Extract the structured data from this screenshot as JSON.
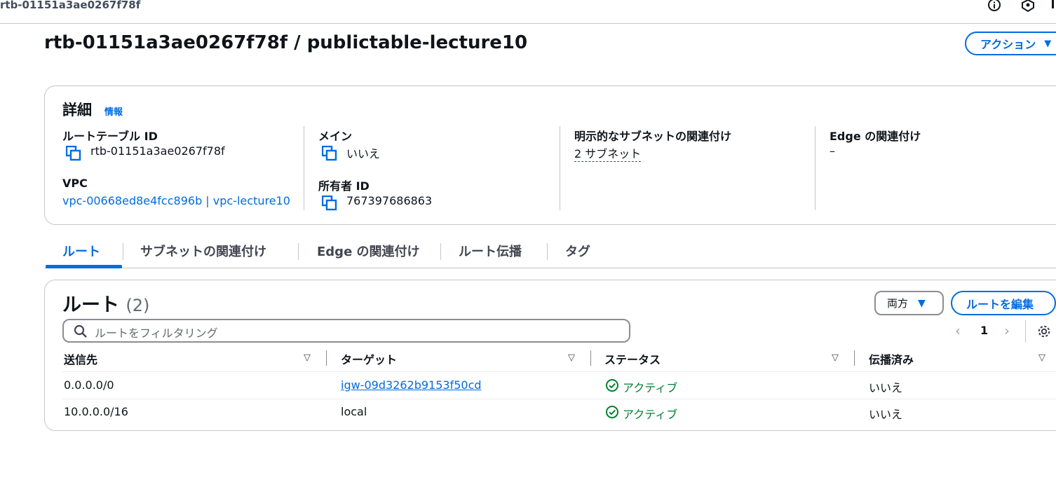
{
  "breadcrumb": "rtb-01151a3ae0267f78f",
  "page": {
    "title": "rtb-01151a3ae0267f78f / publictable-lecture10",
    "actions_label": "アクション",
    "actions_caret": "▼"
  },
  "details": {
    "title": "詳細",
    "info": "情報",
    "route_table_id_label": "ルートテーブル ID",
    "route_table_id": "rtb-01151a3ae0267f78f",
    "vpc_label": "VPC",
    "vpc_value": "vpc-00668ed8e4fcc896b | vpc-lecture10",
    "main_label": "メイン",
    "main_value": "いいえ",
    "owner_label": "所有者 ID",
    "owner_value": "767397686863",
    "explicit_label": "明示的なサブネットの関連付け",
    "explicit_value": "2 サブネット",
    "edge_label": "Edge の関連付け",
    "edge_value": "–"
  },
  "tabs": [
    {
      "label": "ルート",
      "active": true
    },
    {
      "label": "サブネットの関連付け",
      "active": false
    },
    {
      "label": "Edge の関連付け",
      "active": false
    },
    {
      "label": "ルート伝播",
      "active": false
    },
    {
      "label": "タグ",
      "active": false
    }
  ],
  "routes": {
    "title": "ルート",
    "count": "(2)",
    "direction_label": "両方",
    "direction_caret": "▼",
    "edit_label": "ルートを編集",
    "search_placeholder": "ルートをフィルタリング",
    "page_number": "1",
    "pager_prev": "‹",
    "pager_next": "›",
    "columns": [
      "送信先",
      "ターゲット",
      "ステータス",
      "伝播済み"
    ],
    "sort_glyph": "▽",
    "rows": [
      {
        "destination": "0.0.0.0/0",
        "target": "igw-09d3262b9153f50cd",
        "status": "アクティブ",
        "propagated": "いいえ"
      },
      {
        "destination": "10.0.0.0/16",
        "target": "local",
        "status": "アクティブ",
        "propagated": "いいえ"
      }
    ]
  },
  "colors": {
    "accent": "#006ce0",
    "success": "#00802f",
    "border": "#c6c6cd"
  },
  "icons": [
    "info-icon",
    "shield-icon",
    "copy-icon",
    "search-icon",
    "gear-icon",
    "status-success-icon"
  ]
}
